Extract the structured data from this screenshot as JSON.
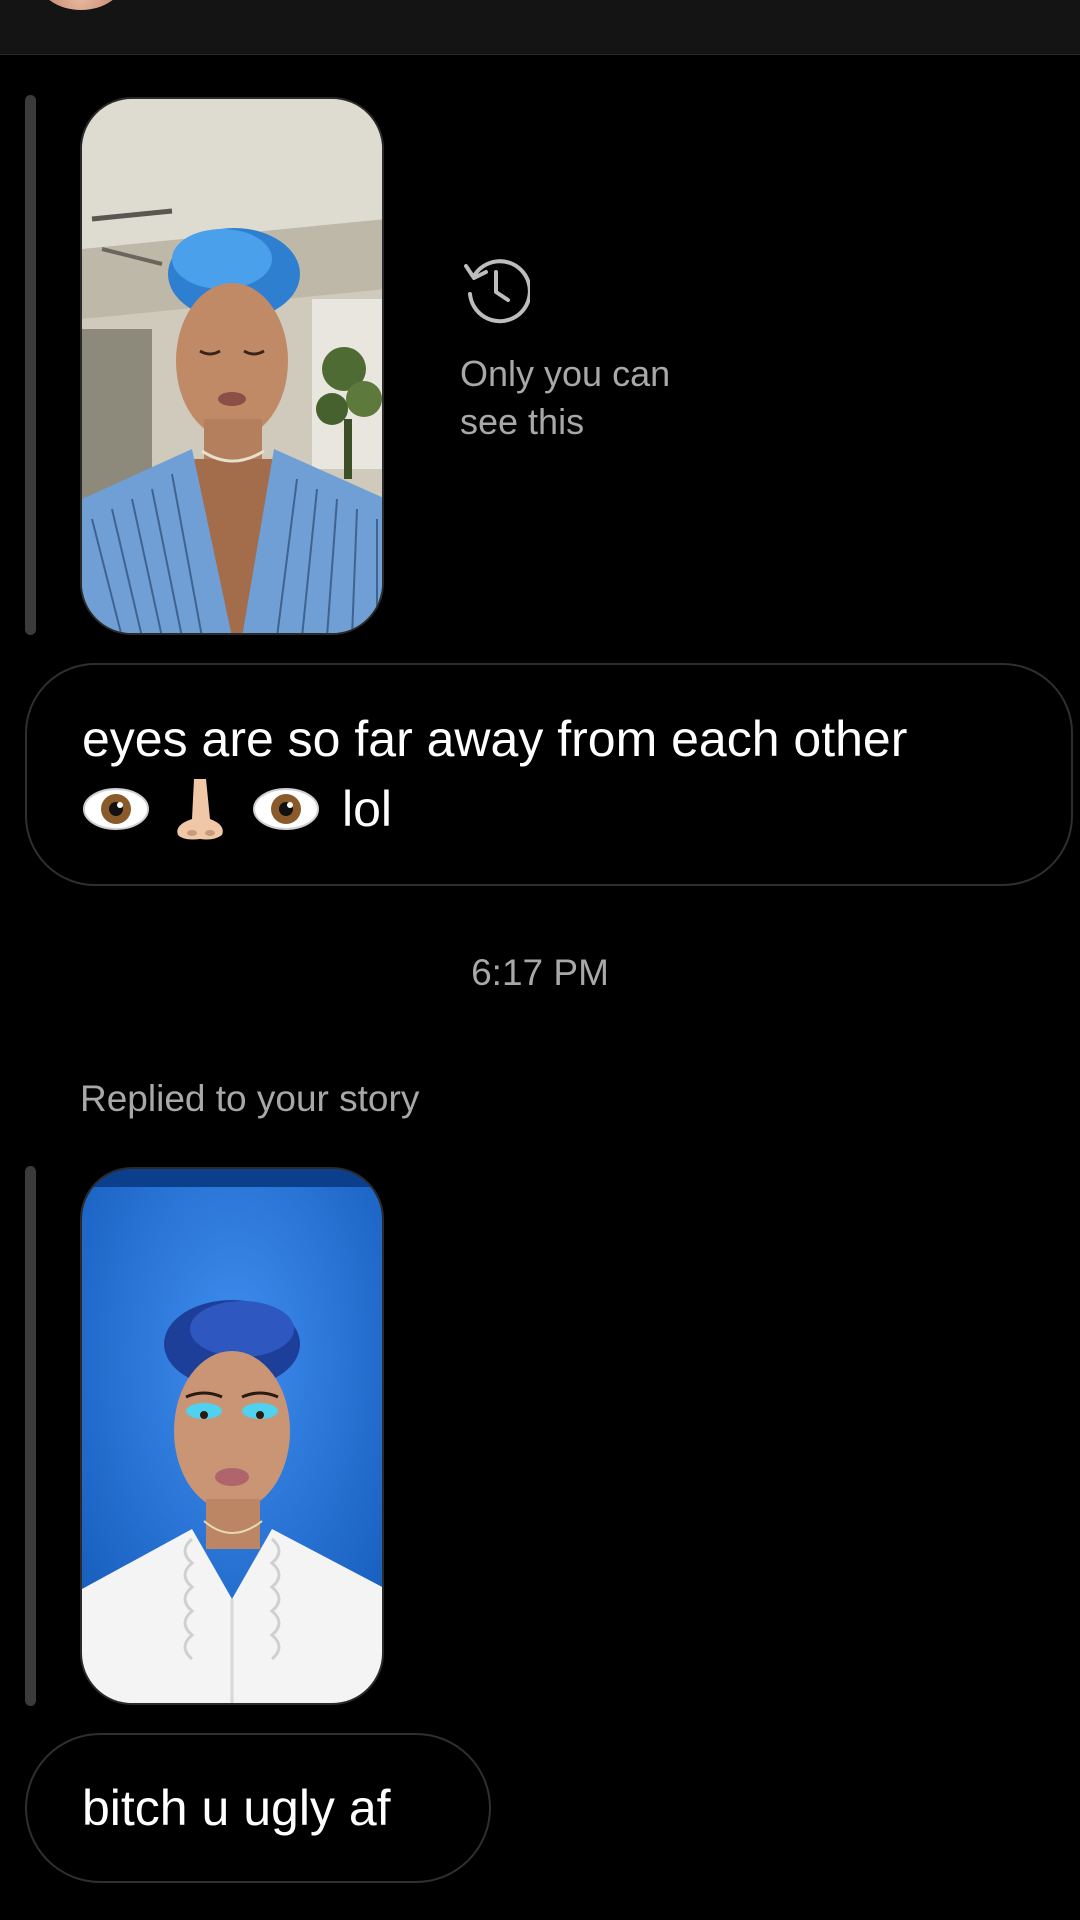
{
  "story_reply_1": {
    "note_icon": "history-icon",
    "note_text": "Only you can see this"
  },
  "message_1": {
    "line1": "eyes are so far away from each other",
    "emojis": [
      "eye-emoji",
      "nose-emoji",
      "eye-emoji"
    ],
    "trailing_text": "lol"
  },
  "timestamp": "6:17 PM",
  "story_reply_2": {
    "label": "Replied to your story"
  },
  "message_2": {
    "text": "bitch u ugly af"
  },
  "colors": {
    "background": "#000000",
    "bubble_border": "#2f2f2f",
    "secondary_text": "#a8a8a8",
    "reply_bar": "#3b3b3b"
  }
}
